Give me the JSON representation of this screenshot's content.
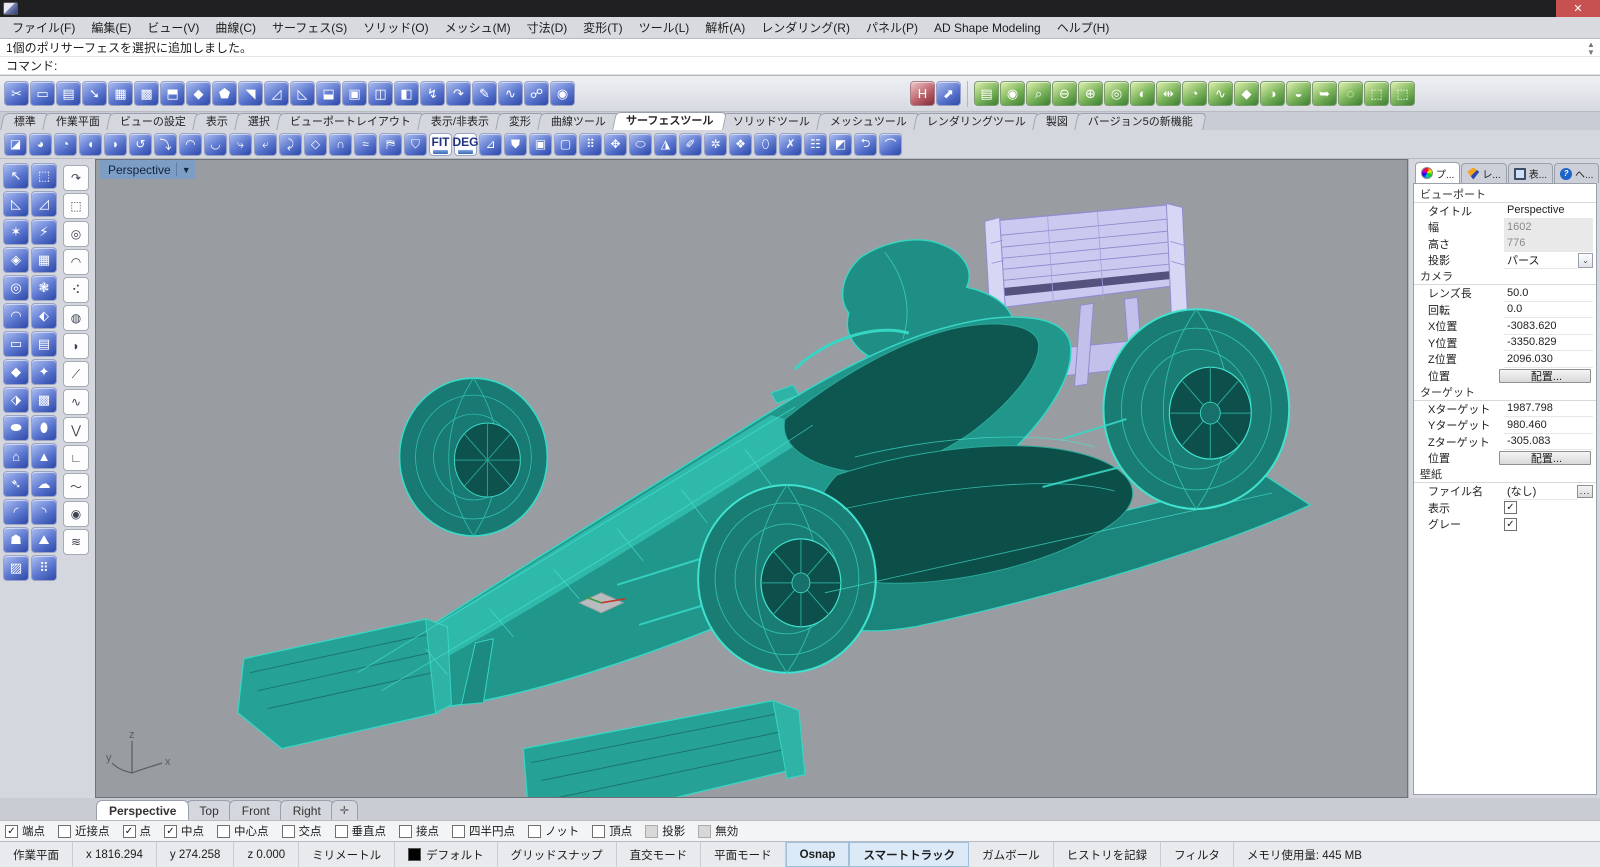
{
  "window": {
    "close_label": "✕"
  },
  "colors": {
    "viewport_bg": "#999da1",
    "teal_surface": "#21968b",
    "teal_dark": "#0e5750",
    "teal_edge": "#3fe3d0",
    "lavender": "#ccc9f0",
    "highlight_blue": "#7e9dc4",
    "close_red": "#c75050",
    "active_status": "#dceaf7"
  },
  "menu_bar": {
    "items": [
      {
        "label": "ファイル(F)",
        "name": "menu-file"
      },
      {
        "label": "編集(E)",
        "name": "menu-edit"
      },
      {
        "label": "ビュー(V)",
        "name": "menu-view"
      },
      {
        "label": "曲線(C)",
        "name": "menu-curve"
      },
      {
        "label": "サーフェス(S)",
        "name": "menu-surface"
      },
      {
        "label": "ソリッド(O)",
        "name": "menu-solid"
      },
      {
        "label": "メッシュ(M)",
        "name": "menu-mesh"
      },
      {
        "label": "寸法(D)",
        "name": "menu-dimension"
      },
      {
        "label": "変形(T)",
        "name": "menu-transform"
      },
      {
        "label": "ツール(L)",
        "name": "menu-tools"
      },
      {
        "label": "解析(A)",
        "name": "menu-analyze"
      },
      {
        "label": "レンダリング(R)",
        "name": "menu-render"
      },
      {
        "label": "パネル(P)",
        "name": "menu-panels"
      },
      {
        "label": "AD Shape Modeling",
        "name": "menu-ad-shape-modeling"
      },
      {
        "label": "ヘルプ(H)",
        "name": "menu-help"
      }
    ]
  },
  "command": {
    "history": "1個のポリサーフェスを選択に追加しました。",
    "prompt": "コマンド:",
    "scroll_up": "▲",
    "scroll_down": "▼"
  },
  "toolbar1": {
    "left": [
      {
        "g": "✂",
        "name": "link-edit-icon"
      },
      {
        "g": "▭",
        "name": "flatten-icon"
      },
      {
        "g": "▤",
        "name": "notebook-icon"
      },
      {
        "g": "➘",
        "name": "brush-stroke-icon"
      },
      {
        "g": "▦",
        "name": "grid-frame-icon"
      },
      {
        "g": "▩",
        "name": "grid-shade-icon"
      },
      {
        "g": "⬒",
        "name": "flag-panel-icon"
      },
      {
        "g": "◆",
        "name": "kite-surface-icon"
      },
      {
        "g": "⬟",
        "name": "pentagon-surface-icon"
      },
      {
        "g": "◥",
        "name": "shield-surface-icon"
      },
      {
        "g": "◿",
        "name": "corner-surface-icon"
      },
      {
        "g": "◺",
        "name": "corner-back-icon"
      },
      {
        "g": "⬓",
        "name": "door-fold-icon"
      },
      {
        "g": "▣",
        "name": "window-inset-icon"
      },
      {
        "g": "◫",
        "name": "window-pair-icon"
      },
      {
        "g": "◧",
        "name": "panel-swap-icon"
      },
      {
        "g": "↯",
        "name": "runner-icon"
      },
      {
        "g": "↷",
        "name": "hook-curve-icon"
      },
      {
        "g": "✎",
        "name": "pen-curve-icon"
      },
      {
        "g": "∿",
        "name": "wave-curve-icon"
      },
      {
        "g": "☍",
        "name": "curve-points-icon"
      },
      {
        "g": "◉",
        "name": "eye-icon"
      }
    ],
    "mid": [
      {
        "g": "H",
        "name": "html-export-icon",
        "cls": "red"
      },
      {
        "g": "⬈",
        "name": "send-view-icon"
      }
    ],
    "right": [
      {
        "g": "▤",
        "name": "layer-book-icon",
        "cls": "green"
      },
      {
        "g": "◉",
        "name": "bulb-search-icon",
        "cls": "green"
      },
      {
        "g": "⌕",
        "name": "zoom-mouse-icon",
        "cls": "green"
      },
      {
        "g": "⊖",
        "name": "zoom-out-icon",
        "cls": "green"
      },
      {
        "g": "⊕",
        "name": "zoom-in-icon",
        "cls": "green"
      },
      {
        "g": "◎",
        "name": "lens-icon",
        "cls": "green"
      },
      {
        "g": "◐",
        "name": "sphere-stripe-icon",
        "cls": "green"
      },
      {
        "g": "⇹",
        "name": "pin-measure-icon",
        "cls": "green"
      },
      {
        "g": "◔",
        "name": "fan-surface-icon",
        "cls": "green"
      },
      {
        "g": "∿",
        "name": "wave-analysis-icon",
        "cls": "green"
      },
      {
        "g": "◆",
        "name": "draft-angle-icon",
        "cls": "green"
      },
      {
        "g": "◑",
        "name": "curvature-map-icon",
        "cls": "green"
      },
      {
        "g": "◒",
        "name": "zebra-analysis-icon",
        "cls": "green"
      },
      {
        "g": "➥",
        "name": "environment-map-icon",
        "cls": "green"
      },
      {
        "g": "◌",
        "name": "ghost-select-icon",
        "cls": "green"
      },
      {
        "g": "⬚",
        "name": "dashed-select-icon",
        "cls": "green"
      },
      {
        "g": "⬚",
        "name": "dashed-select-2-icon",
        "cls": "green"
      }
    ]
  },
  "toolbar_tabs": {
    "items": [
      {
        "label": "標準",
        "name": "tab-standard"
      },
      {
        "label": "作業平面",
        "name": "tab-cplane"
      },
      {
        "label": "ビューの設定",
        "name": "tab-view-settings"
      },
      {
        "label": "表示",
        "name": "tab-display"
      },
      {
        "label": "選択",
        "name": "tab-select"
      },
      {
        "label": "ビューポートレイアウト",
        "name": "tab-viewport-layout"
      },
      {
        "label": "表示/非表示",
        "name": "tab-show-hide"
      },
      {
        "label": "変形",
        "name": "tab-transform"
      },
      {
        "label": "曲線ツール",
        "name": "tab-curve-tools"
      },
      {
        "label": "サーフェスツール",
        "name": "tab-surface-tools",
        "active": true
      },
      {
        "label": "ソリッドツール",
        "name": "tab-solid-tools"
      },
      {
        "label": "メッシュツール",
        "name": "tab-mesh-tools"
      },
      {
        "label": "レンダリングツール",
        "name": "tab-render-tools"
      },
      {
        "label": "製図",
        "name": "tab-drafting"
      },
      {
        "label": "バージョン5の新機能",
        "name": "tab-v5-new-features"
      }
    ]
  },
  "toolbar2": {
    "items": [
      {
        "g": "◪",
        "name": "srf-3pt-icon"
      },
      {
        "g": "◕",
        "name": "srf-corner-icon"
      },
      {
        "g": "◔",
        "name": "srf-edge-icon"
      },
      {
        "g": "◖",
        "name": "loft-icon"
      },
      {
        "g": "◗",
        "name": "sweep1-icon"
      },
      {
        "g": "↺",
        "name": "sweep2-icon"
      },
      {
        "g": "⤵",
        "name": "revolve-icon"
      },
      {
        "g": "◠",
        "name": "rail-revolve-icon"
      },
      {
        "g": "◡",
        "name": "extrude-straight-icon"
      },
      {
        "g": "⤷",
        "name": "extrude-along-icon"
      },
      {
        "g": "⤶",
        "name": "extrude-tapered-icon"
      },
      {
        "g": "⤸",
        "name": "extrude-point-icon"
      },
      {
        "g": "◇",
        "name": "cage-edit-icon"
      },
      {
        "g": "∩",
        "name": "pipe-icon"
      },
      {
        "g": "≈",
        "name": "blend-srf-icon"
      },
      {
        "g": "⛿",
        "name": "patch-icon"
      },
      {
        "g": "⛉",
        "name": "drape-icon"
      },
      {
        "g": "FIT",
        "name": "fit-srf-icon",
        "cls": "txt"
      },
      {
        "g": "DEG",
        "name": "change-degree-icon",
        "cls": "txt"
      },
      {
        "g": "⊿",
        "name": "offset-srf-icon"
      },
      {
        "g": "⛊",
        "name": "fillet-srf-icon"
      },
      {
        "g": "▣",
        "name": "connect-srf-icon"
      },
      {
        "g": "▢",
        "name": "symmetry-icon"
      },
      {
        "g": "⠿",
        "name": "unroll-icon"
      },
      {
        "g": "✥",
        "name": "smash-icon"
      },
      {
        "g": "⬭",
        "name": "squish-icon"
      },
      {
        "g": "◮",
        "name": "shrink-trimmed-icon"
      },
      {
        "g": "✐",
        "name": "rebuild-icon"
      },
      {
        "g": "✲",
        "name": "match-srf-icon"
      },
      {
        "g": "❖",
        "name": "merge-srf-icon"
      },
      {
        "g": "⬯",
        "name": "join-edges-icon"
      },
      {
        "g": "✗",
        "name": "untrim-icon"
      },
      {
        "g": "☷",
        "name": "trim-icon"
      },
      {
        "g": "◩",
        "name": "split-icon"
      },
      {
        "g": "⮌",
        "name": "extend-srf-icon"
      },
      {
        "g": "⌒",
        "name": "history-curve-icon"
      }
    ]
  },
  "left_toolbox": {
    "main": [
      {
        "g": "↖",
        "name": "select-arrow-icon"
      },
      {
        "g": "⬚",
        "name": "move-control-point-icon"
      },
      {
        "g": "◺",
        "name": "trim-tool-icon"
      },
      {
        "g": "◿",
        "name": "split-tool-icon"
      },
      {
        "g": "✶",
        "name": "explode-icon"
      },
      {
        "g": "⚡",
        "name": "extract-icon"
      },
      {
        "g": "◈",
        "name": "patch-quad-icon"
      },
      {
        "g": "▦",
        "name": "patch-flat-icon"
      },
      {
        "g": "◎",
        "name": "circle-srf-icon"
      },
      {
        "g": "❃",
        "name": "fan-srf-icon"
      },
      {
        "g": "◠",
        "name": "swap-srf-icon"
      },
      {
        "g": "⬖",
        "name": "pack-srf-icon"
      },
      {
        "g": "▭",
        "name": "plane-srf-icon"
      },
      {
        "g": "▤",
        "name": "plane-grid-icon"
      },
      {
        "g": "◆",
        "name": "deform-quad-icon"
      },
      {
        "g": "✦",
        "name": "twist-srf-icon"
      },
      {
        "g": "⬗",
        "name": "flip-srf-icon"
      },
      {
        "g": "▩",
        "name": "texture-map-icon"
      },
      {
        "g": "⬬",
        "name": "cylinder-wrap-icon"
      },
      {
        "g": "⬮",
        "name": "drape-srf-icon"
      },
      {
        "g": "⌂",
        "name": "tent-srf-icon"
      },
      {
        "g": "▲",
        "name": "cone-srf-icon"
      },
      {
        "g": "➴",
        "name": "spoon-curve-icon"
      },
      {
        "g": "☁",
        "name": "blob-srf-icon"
      },
      {
        "g": "◜",
        "name": "arc-blend1-icon"
      },
      {
        "g": "◝",
        "name": "arc-blend2-icon"
      },
      {
        "g": "☗",
        "name": "cobra-srf-icon"
      },
      {
        "g": "⛰",
        "name": "dome-srf-icon"
      },
      {
        "g": "▨",
        "name": "checker-map-icon"
      },
      {
        "g": "⠿",
        "name": "point-grid-icon"
      }
    ],
    "side": [
      {
        "g": "↷",
        "name": "curve-handles-icon"
      },
      {
        "g": "⬚",
        "name": "rect-points-icon"
      },
      {
        "g": "◎",
        "name": "circle-points-icon"
      },
      {
        "g": "◠",
        "name": "arc-points-icon"
      },
      {
        "g": "⠪",
        "name": "point-cloud-icon"
      },
      {
        "g": "◍",
        "name": "mesh-sphere-icon"
      },
      {
        "g": "◗",
        "name": "freeform-curve-icon"
      },
      {
        "g": "⟋",
        "name": "line-2pt-icon"
      },
      {
        "g": "∿",
        "name": "curve-s-icon"
      },
      {
        "g": "⋁",
        "name": "polyline-v-icon"
      },
      {
        "g": "∟",
        "name": "polyline-right-icon"
      },
      {
        "g": "〜",
        "name": "sketch-curve-icon"
      },
      {
        "g": "◉",
        "name": "concentric-circle-icon"
      },
      {
        "g": "≋",
        "name": "radial-arcs-icon"
      }
    ]
  },
  "viewport": {
    "label": "Perspective",
    "dropdown_arrow": "▼",
    "axis_x": "x",
    "axis_y": "y",
    "axis_z": "z"
  },
  "panel": {
    "tabs": [
      {
        "label": "プ...",
        "name": "panel-tab-properties",
        "icon": "wheel",
        "active": true,
        "icon_glyph": ""
      },
      {
        "label": "レ...",
        "name": "panel-tab-layers",
        "icon": "layers",
        "icon_glyph": ""
      },
      {
        "label": "表...",
        "name": "panel-tab-display",
        "icon": "display",
        "icon_glyph": ""
      },
      {
        "label": "ヘ...",
        "name": "panel-tab-help",
        "icon": "help",
        "icon_glyph": "?"
      }
    ],
    "gear_glyph": "⚙",
    "rows": [
      {
        "section": true,
        "label": "ビューポート"
      },
      {
        "label": "タイトル",
        "value": "Perspective"
      },
      {
        "label": "幅",
        "value": "1602",
        "muted": true
      },
      {
        "label": "高さ",
        "value": "776",
        "muted": true
      },
      {
        "label": "投影",
        "value": "パース",
        "dropdown": true,
        "extra": "⌄"
      },
      {
        "section": true,
        "label": "カメラ"
      },
      {
        "label": "レンズ長",
        "value": "50.0"
      },
      {
        "label": "回転",
        "value": "0.0"
      },
      {
        "label": "X位置",
        "value": "-3083.620"
      },
      {
        "label": "Y位置",
        "value": "-3350.829"
      },
      {
        "label": "Z位置",
        "value": "2096.030"
      },
      {
        "label": "位置",
        "value": "配置...",
        "button": true
      },
      {
        "section": true,
        "label": "ターゲット"
      },
      {
        "label": "Xターゲット",
        "value": "1987.798"
      },
      {
        "label": "Yターゲット",
        "value": "980.460"
      },
      {
        "label": "Zターゲット",
        "value": "-305.083"
      },
      {
        "label": "位置",
        "value": "配置...",
        "button": true
      },
      {
        "section": true,
        "label": "壁紙"
      },
      {
        "label": "ファイル名",
        "value": "(なし)",
        "file": true,
        "extra": "..."
      },
      {
        "label": "表示",
        "value": "✓",
        "checkbox": true
      },
      {
        "label": "グレー",
        "value": "✓",
        "checkbox": true
      }
    ]
  },
  "viewport_tabs": {
    "items": [
      {
        "label": "Perspective",
        "name": "vtab-perspective",
        "active": true
      },
      {
        "label": "Top",
        "name": "vtab-top"
      },
      {
        "label": "Front",
        "name": "vtab-front"
      },
      {
        "label": "Right",
        "name": "vtab-right"
      },
      {
        "label": "✛",
        "name": "vtab-add",
        "plus": true
      }
    ]
  },
  "osnap": {
    "items": [
      {
        "label": "端点",
        "checked": true
      },
      {
        "label": "近接点"
      },
      {
        "label": "点",
        "checked": true
      },
      {
        "label": "中点",
        "checked": true
      },
      {
        "label": "中心点"
      },
      {
        "label": "交点"
      },
      {
        "label": "垂直点"
      },
      {
        "label": "接点"
      },
      {
        "label": "四半円点"
      },
      {
        "label": "ノット"
      },
      {
        "label": "頂点"
      },
      {
        "label": "投影",
        "disabled": true
      },
      {
        "label": "無効",
        "disabled": true
      }
    ]
  },
  "status_bar": {
    "items": [
      {
        "label": "作業平面",
        "name": "status-cplane"
      },
      {
        "label": "x 1816.294",
        "name": "status-x"
      },
      {
        "label": "y 274.258",
        "name": "status-y"
      },
      {
        "label": "z 0.000",
        "name": "status-z"
      },
      {
        "label": "ミリメートル",
        "name": "status-units"
      },
      {
        "label": "デフォルト",
        "name": "status-layer",
        "swatch": true
      },
      {
        "label": "グリッドスナップ",
        "name": "status-grid-snap"
      },
      {
        "label": "直交モード",
        "name": "status-ortho"
      },
      {
        "label": "平面モード",
        "name": "status-planar"
      },
      {
        "label": "Osnap",
        "name": "status-osnap",
        "active": true
      },
      {
        "label": "スマートトラック",
        "name": "status-smarttrack",
        "active": true
      },
      {
        "label": "ガムボール",
        "name": "status-gumball"
      },
      {
        "label": "ヒストリを記録",
        "name": "status-record-history"
      },
      {
        "label": "フィルタ",
        "name": "status-filter"
      },
      {
        "label": "メモリ使用量: 445 MB",
        "name": "status-memory",
        "grow": true
      }
    ]
  }
}
